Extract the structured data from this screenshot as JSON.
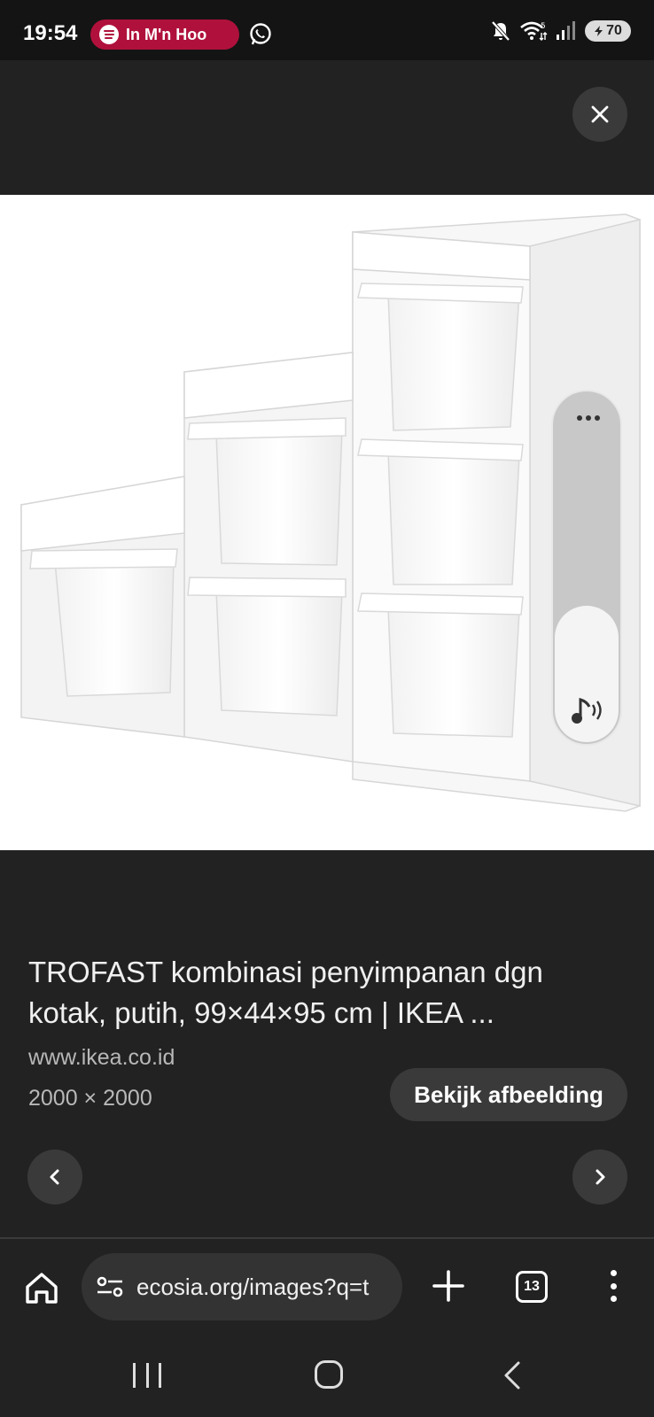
{
  "status_bar": {
    "time": "19:54",
    "spotify_text": "In M'n Hoo",
    "battery": "70",
    "icons": [
      "spotify-icon",
      "whatsapp-icon",
      "mute-icon",
      "wifi-icon",
      "signal-icon",
      "battery-icon"
    ]
  },
  "viewer": {
    "close_icon": "close-icon",
    "image_alt": "TROFAST storage shelf with white boxes",
    "title": "TROFAST kombinasi penyimpanan dgn kotak, putih, 99×44×95 cm | IKEA ...",
    "source_url": "www.ikea.co.id",
    "dimensions": "2000 × 2000",
    "view_image_label": "Bekijk afbeelding",
    "prev_icon": "chevron-left-icon",
    "next_icon": "chevron-right-icon"
  },
  "side_widget": {
    "more_icon": "more-dots-icon",
    "audio_icon": "audio-note-icon"
  },
  "browser": {
    "url": "ecosia.org/images?q=t",
    "tab_count": "13",
    "home_icon": "home-icon",
    "new_tab_icon": "plus-icon",
    "menu_icon": "kebab-menu-icon"
  },
  "colors": {
    "background": "#222222",
    "status_bar": "#141414",
    "spotify_pill": "#b0113c",
    "button_bg": "#3a3a3a"
  }
}
